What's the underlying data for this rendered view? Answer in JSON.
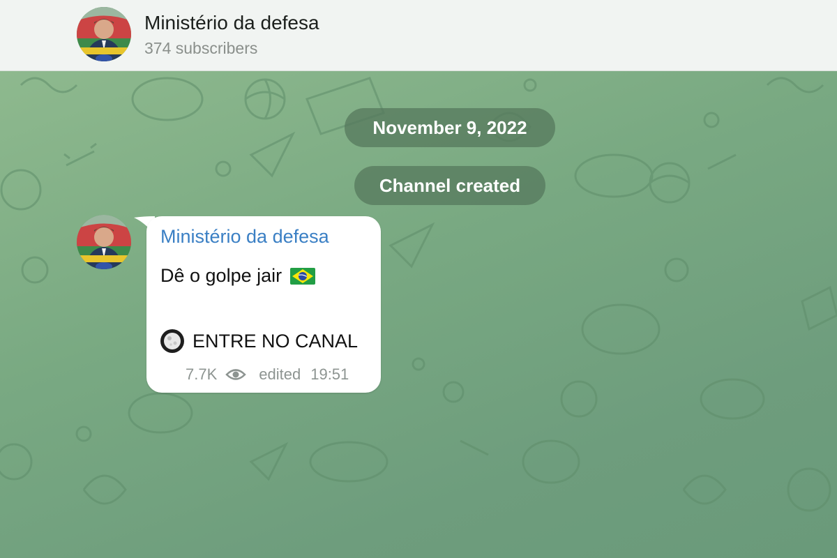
{
  "header": {
    "title": "Ministério da defesa",
    "subtitle": "374 subscribers"
  },
  "service": {
    "date": "November 9, 2022",
    "created": "Channel created"
  },
  "message": {
    "sender": "Ministério da defesa",
    "line1": "Dê o golpe jair",
    "line2": "ENTRE NO CANAL",
    "views": "7.7K",
    "edited_label": "edited",
    "time": "19:51"
  },
  "icons": {
    "flag": "brazil-flag-icon",
    "moon": "full-moon-icon",
    "views": "eye-icon"
  },
  "colors": {
    "header_bg": "#f1f4f2",
    "chat_bg": "#79a982",
    "sender": "#3a7fc4",
    "pill_bg": "#56785c"
  }
}
